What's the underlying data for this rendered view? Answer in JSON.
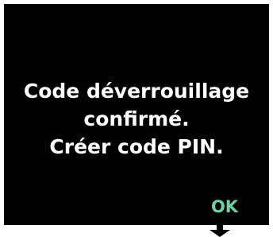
{
  "dialog": {
    "message_lines": [
      "Code déverrouillage",
      "confirmé.",
      "Créer code PIN."
    ],
    "ok_label": "OK"
  },
  "colors": {
    "screen_background": "#000000",
    "text": "#ffffff",
    "ok_accent": "#6fd0a6",
    "arrow": "#000000"
  },
  "icons": {
    "below_ok": "arrow-down-icon"
  }
}
